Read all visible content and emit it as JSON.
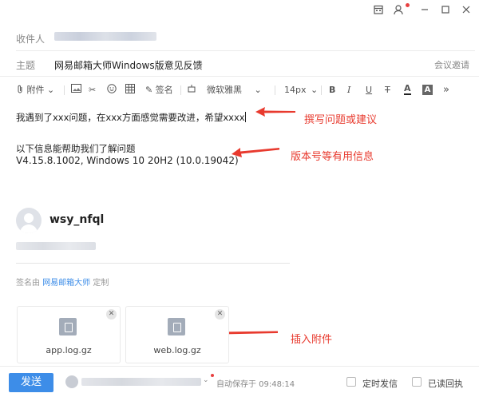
{
  "titlebar": {
    "icons": [
      "calendar-icon",
      "contacts-icon",
      "minimize-icon",
      "maximize-icon",
      "close-icon"
    ]
  },
  "header": {
    "to_label": "收件人",
    "subject_label": "主题",
    "subject_value": "网易邮箱大师Windows版意见反馈",
    "meeting_label": "会议邀请"
  },
  "toolbar": {
    "attach_label": "附件",
    "signature_label": "签名",
    "font_family": "微软雅黑",
    "font_size": "14px",
    "more_symbol": "»"
  },
  "body": {
    "line1": "我遇到了xxx问题，在xxx方面感觉需要改进，希望xxxx",
    "line2": "以下信息能帮助我们了解问题",
    "line3": "V4.15.8.1002, Windows 10 20H2 (10.0.19042)"
  },
  "annotations": {
    "a1": "撰写问题或建议",
    "a2": "版本号等有用信息",
    "a3": "插入附件",
    "color": "#e83a2e"
  },
  "signature": {
    "name": "wsy_nfql",
    "by_prefix": "签名由",
    "by_link": "网易邮箱大师",
    "by_suffix": "定制"
  },
  "attachments": [
    {
      "name": "app.log.gz"
    },
    {
      "name": "web.log.gz"
    }
  ],
  "footer": {
    "send_label": "发送",
    "autosave_text": "自动保存于 09:48:14",
    "scheduled_label": "定时发信",
    "receipt_label": "已读回执",
    "accent": "#3d8de8"
  }
}
